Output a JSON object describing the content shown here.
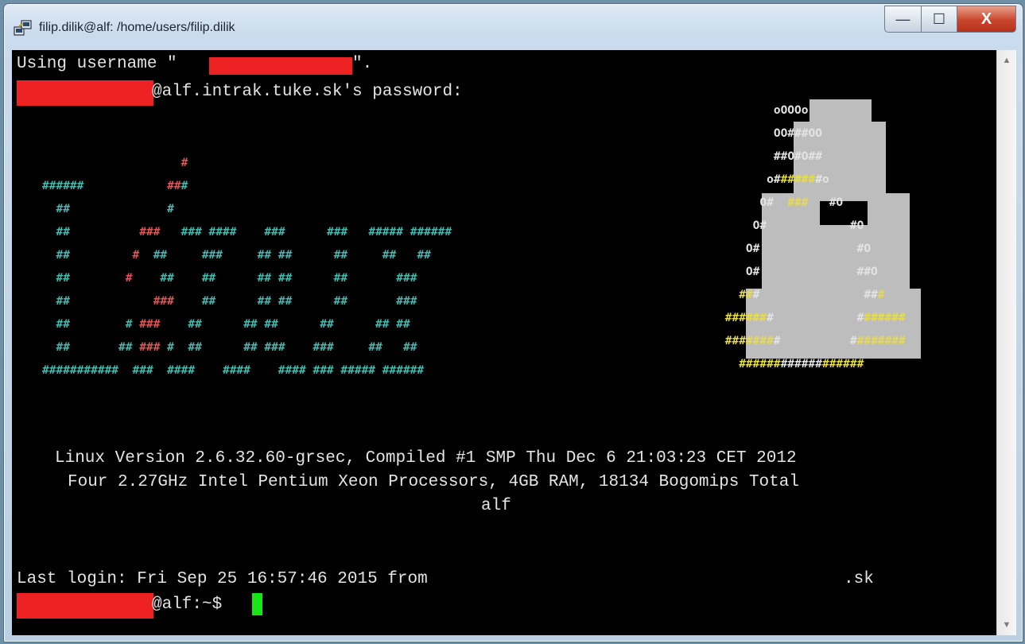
{
  "window": {
    "title": "filip.dilik@alf: /home/users/filip.dilik",
    "controls": {
      "minimize": "—",
      "maximize": "☐",
      "close": "X"
    }
  },
  "terminal": {
    "line1_pre": "Using username \"",
    "line1_post": "\".",
    "line2": "@alf.intrak.tuke.sk's password:",
    "sysinfo1": "Linux Version 2.6.32.60-grsec, Compiled #1 SMP Thu Dec 6 21:03:23 CET 2012",
    "sysinfo2": "Four 2.27GHz Intel Pentium Xeon Processors, 4GB RAM, 18134 Bogomips Total",
    "hostname": "alf",
    "last_login": "Last login: Fri Sep 25 16:57:46 2015 from",
    "last_login_domain": ".sk",
    "prompt": "@alf:~$"
  },
  "colors": {
    "cyan": "#47b8b0",
    "red": "#e05555",
    "yellow": "#e8dc48",
    "cursor": "#19e619",
    "redaction": "#ee2222"
  }
}
